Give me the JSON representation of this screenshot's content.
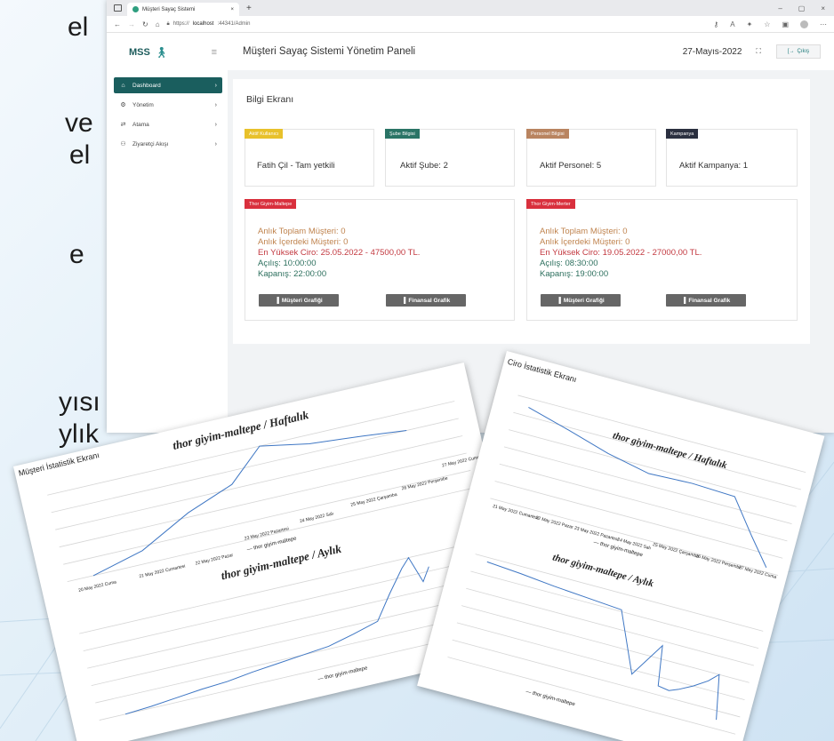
{
  "slide_text": [
    "el",
    "ve",
    "el",
    "e",
    "yısı",
    "ylık"
  ],
  "browser": {
    "tab_title": "Müşteri Sayaç Sistemi",
    "tab_close": "×",
    "new_tab": "+",
    "url_scheme": "https://",
    "url_host": "localhost",
    "url_rest": ":44341/Admin",
    "window_controls": [
      "–",
      "▢",
      "×"
    ]
  },
  "app": {
    "logo": "MSS",
    "nav": [
      {
        "icon": "⌂",
        "label": "Dashboard",
        "active": true
      },
      {
        "icon": "⚙",
        "label": "Yönetim",
        "active": false
      },
      {
        "icon": "⇄",
        "label": "Atama",
        "active": false
      },
      {
        "icon": "⚇",
        "label": "Ziyaretçi Akışı",
        "active": false
      }
    ],
    "page_title": "Müşteri Sayaç Sistemi Yönetim Paneli",
    "date": "27-Mayıs-2022",
    "logout_label": "Çıkış",
    "panel_title": "Bilgi Ekranı",
    "info_cards": [
      {
        "badge": "Aktif Kullanıcı",
        "value": "Fatih Çil - Tam yetkili",
        "color": "#e8c12b"
      },
      {
        "badge": "Şube Bilgisi",
        "value": "Aktif Şube: 2",
        "color": "#2a7466"
      },
      {
        "badge": "Personel Bilgisi",
        "value": "Aktif Personel: 5",
        "color": "#b98460"
      },
      {
        "badge": "Kampanya",
        "value": "Aktif Kampanya: 1",
        "color": "#2b3040"
      }
    ],
    "branches": [
      {
        "badge": "Thor Giyim-Maltepe",
        "toplam": "Anlık Toplam Müşteri: 0",
        "icerde": "Anlık İçerdeki Müşteri: 0",
        "ciro": "En Yüksek Ciro: 25.05.2022 - 47500,00 TL.",
        "acilis": "Açılış: 10:00:00",
        "kapanis": "Kapanış: 22:00:00",
        "btn_musteri": "Müşteri Grafiği",
        "btn_finansal": "Finansal Grafik"
      },
      {
        "badge": "Thor Giyim-Merter",
        "toplam": "Anlık Toplam Müşteri: 0",
        "icerde": "Anlık İçerdeki Müşteri: 0",
        "ciro": "En Yüksek Ciro: 19.05.2022 - 27000,00 TL.",
        "acilis": "Açılış: 08:30:00",
        "kapanis": "Kapanış: 19:00:00",
        "btn_musteri": "Müşteri Grafiği",
        "btn_finansal": "Finansal Grafik"
      }
    ],
    "colors": {
      "primary": "#1a5e5e",
      "badge_red": "#d9303d"
    }
  },
  "papers": {
    "left": {
      "screen_title": "Müşteri İstatistik Ekranı",
      "title_weekly": "thor giyim-maltepe / Haftalık",
      "title_monthly": "thor giyim-maltepe / Aylık",
      "legend_weekly": "— thor giyim-maltepe",
      "legend_monthly": "— thor giyim-maltepe",
      "weekly_ticks": [
        "20 May 2022 Cuma",
        "21 May 2022 Cumartesi",
        "22 May 2022 Pazar",
        "23 May 2022 Pazartesi",
        "24 May 2022 Salı",
        "25 May 2022 Çarşamba",
        "26 May 2022 Perşembe",
        "27 May 2022 Cuma"
      ]
    },
    "right": {
      "screen_title": "Ciro İstatistik Ekranı",
      "title_weekly": "thor giyim-maltepe / Haftalık",
      "title_monthly": "thor giyim-maltepe / Aylık",
      "legend_weekly": "— thor giyim-maltepe",
      "legend_monthly": "— thor giyim-maltepe",
      "weekly_ticks": [
        "21 May 2022 Cumartesi",
        "22 May 2022 Pazar",
        "23 May 2022 Pazartesi",
        "24 May 2022 Salı",
        "25 May 2022 Çarşamba",
        "26 May 2022 Perşembe",
        "27 May 2022 Cuma"
      ]
    }
  }
}
